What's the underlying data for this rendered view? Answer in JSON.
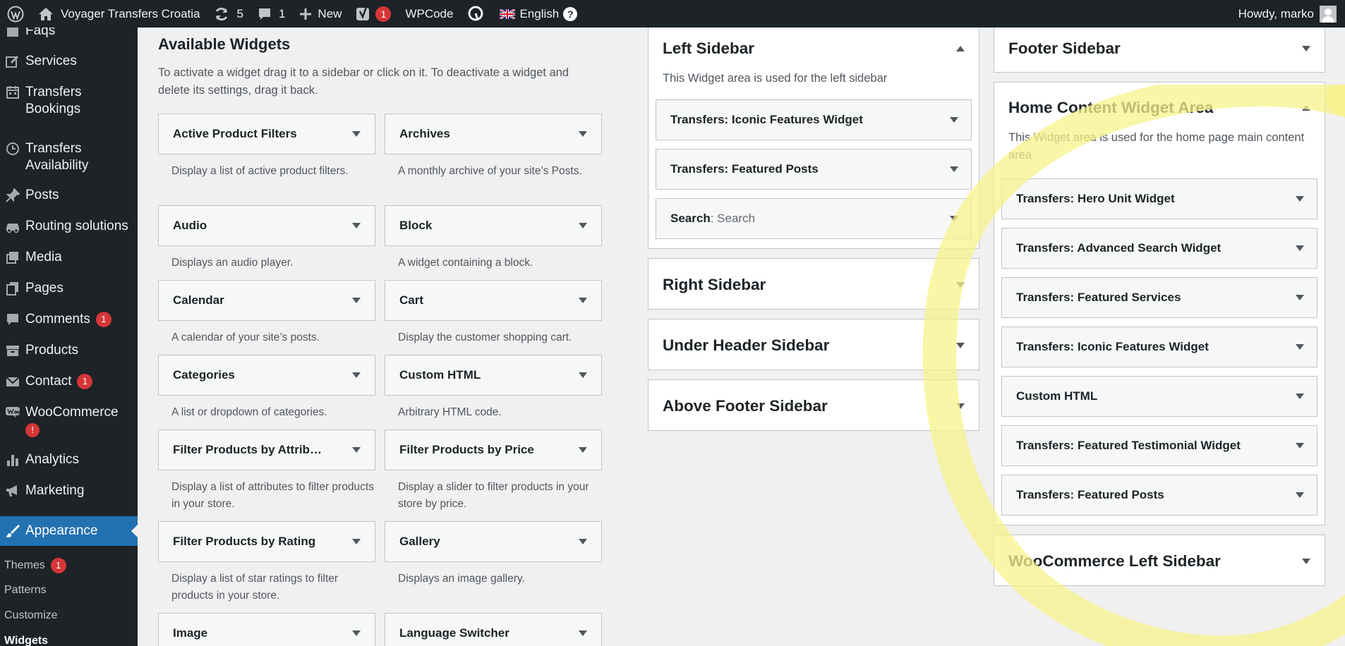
{
  "adminbar": {
    "site_name": "Voyager Transfers Croatia",
    "updates_count": "5",
    "comments_count": "1",
    "new_label": "New",
    "yoast_badge": "1",
    "wpcode_label": "WPCode",
    "language_label": "English",
    "help_symbol": "?",
    "howdy": "Howdy, marko"
  },
  "menu": {
    "items": [
      {
        "label": "Faqs",
        "icon": "faq-icon"
      },
      {
        "label": "Services",
        "icon": "edit-icon"
      },
      {
        "label": "Transfers Bookings",
        "line1": "Transfers",
        "line2": "Bookings",
        "icon": "calendar-icon"
      },
      {
        "label": "Transfers Availability",
        "line1": "Transfers",
        "line2": "Availability",
        "icon": "clock-icon"
      },
      {
        "label": "Posts",
        "icon": "pin-icon"
      },
      {
        "label": "Routing solutions",
        "icon": "car-icon"
      },
      {
        "label": "Media",
        "icon": "media-icon"
      },
      {
        "label": "Pages",
        "icon": "pages-icon"
      },
      {
        "label": "Comments",
        "icon": "comment-icon",
        "badge": "1"
      },
      {
        "label": "Products",
        "icon": "archive-icon"
      },
      {
        "label": "Contact",
        "icon": "mail-icon",
        "badge": "1"
      },
      {
        "label": "WooCommerce",
        "icon": "woo-icon",
        "badge": "!"
      },
      {
        "label": "Analytics",
        "icon": "chart-icon"
      },
      {
        "label": "Marketing",
        "icon": "megaphone-icon"
      },
      {
        "label": "Appearance",
        "icon": "brush-icon",
        "active": true
      }
    ],
    "submenu": [
      {
        "label": "Themes",
        "badge": "1"
      },
      {
        "label": "Patterns"
      },
      {
        "label": "Customize"
      },
      {
        "label": "Widgets",
        "current": true
      }
    ]
  },
  "available": {
    "title": "Available Widgets",
    "description": "To activate a widget drag it to a sidebar or click on it. To deactivate a widget and delete its settings, drag it back.",
    "widgets": [
      {
        "title": "Active Product Filters",
        "desc": "Display a list of active product filters."
      },
      {
        "title": "Archives",
        "desc": "A monthly archive of your site’s Posts."
      },
      {
        "title": "Audio",
        "desc": "Displays an audio player."
      },
      {
        "title": "Block",
        "desc": "A widget containing a block."
      },
      {
        "title": "Calendar",
        "desc": "A calendar of your site’s posts."
      },
      {
        "title": "Cart",
        "desc": "Display the customer shopping cart."
      },
      {
        "title": "Categories",
        "desc": "A list or dropdown of categories."
      },
      {
        "title": "Custom HTML",
        "desc": "Arbitrary HTML code."
      },
      {
        "title": "Filter Products by Attrib…",
        "desc": "Display a list of attributes to filter products in your store."
      },
      {
        "title": "Filter Products by Price",
        "desc": "Display a slider to filter products in your store by price."
      },
      {
        "title": "Filter Products by Rating",
        "desc": "Display a list of star ratings to filter products in your store."
      },
      {
        "title": "Gallery",
        "desc": "Displays an image gallery."
      },
      {
        "title": "Image",
        "desc": ""
      },
      {
        "title": "Language Switcher",
        "desc": ""
      }
    ]
  },
  "areas": {
    "left": {
      "title": "Left Sidebar",
      "description": "This Widget area is used for the left sidebar",
      "widgets": [
        {
          "title": "Transfers: Iconic Features Widget"
        },
        {
          "title": "Transfers: Featured Posts"
        },
        {
          "title": "Search",
          "sub": ": Search"
        }
      ]
    },
    "right": {
      "title": "Right Sidebar"
    },
    "under_header": {
      "title": "Under Header Sidebar"
    },
    "above_footer": {
      "title": "Above Footer Sidebar"
    },
    "footer": {
      "title": "Footer Sidebar"
    },
    "home_content": {
      "title": "Home Content Widget Area",
      "description": "This Widget area is used for the home page main content area",
      "widgets": [
        {
          "title": "Transfers: Hero Unit Widget"
        },
        {
          "title": "Transfers: Advanced Search Widget"
        },
        {
          "title": "Transfers: Featured Services"
        },
        {
          "title": "Transfers: Iconic Features Widget"
        },
        {
          "title": "Custom HTML"
        },
        {
          "title": "Transfers: Featured Testimonial Widget"
        },
        {
          "title": "Transfers: Featured Posts"
        }
      ]
    },
    "woo_left": {
      "title": "WooCommerce Left Sidebar"
    }
  },
  "colors": {
    "admin_dark": "#1d2327",
    "accent_blue": "#2271b1",
    "badge_red": "#d63638",
    "highlight_yellow": "#f7f38a"
  }
}
